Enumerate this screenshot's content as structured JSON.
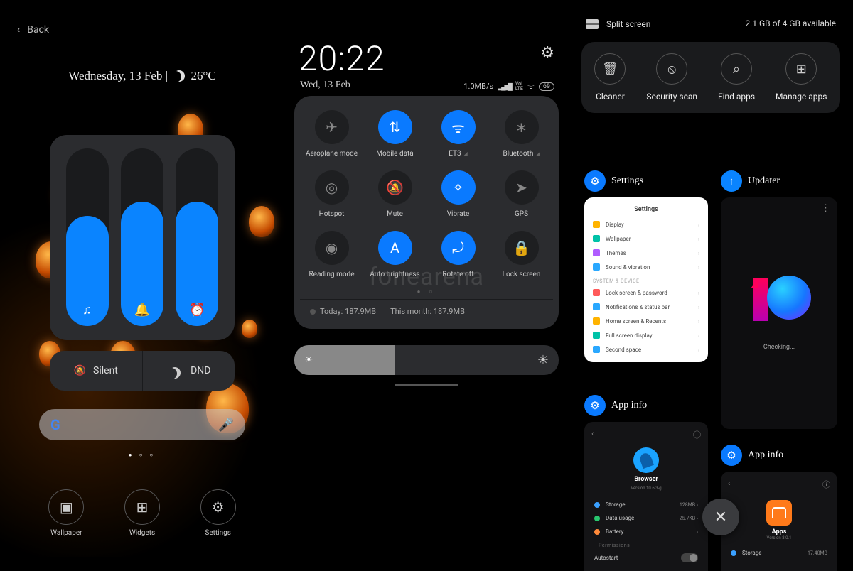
{
  "col1": {
    "back": "Back",
    "date_line": "Wednesday, 13 Feb",
    "temp": "26°C",
    "sliders": [
      {
        "fill_pct": 62
      },
      {
        "fill_pct": 70
      },
      {
        "fill_pct": 70
      }
    ],
    "silent": "Silent",
    "dnd": "DND",
    "dock": [
      {
        "label": "Wallpaper"
      },
      {
        "label": "Widgets"
      },
      {
        "label": "Settings"
      }
    ]
  },
  "col2": {
    "time": "20:22",
    "date": "Wed, 13 Feb",
    "net_speed": "1.0MB/s",
    "battery": "69",
    "toggles": [
      {
        "label": "Aeroplane mode",
        "on": false,
        "glyph": "✈"
      },
      {
        "label": "Mobile data",
        "on": true,
        "glyph": "⇅"
      },
      {
        "label": "ET3",
        "on": true,
        "glyph": "ᯤ",
        "chev": true
      },
      {
        "label": "Bluetooth",
        "on": false,
        "glyph": "∗",
        "chev": true
      },
      {
        "label": "Hotspot",
        "on": false,
        "glyph": "◎"
      },
      {
        "label": "Mute",
        "on": false,
        "glyph": "🔕"
      },
      {
        "label": "Vibrate",
        "on": true,
        "glyph": "✧"
      },
      {
        "label": "GPS",
        "on": false,
        "glyph": "➤"
      },
      {
        "label": "Reading mode",
        "on": false,
        "glyph": "◉"
      },
      {
        "label": "Auto brightness",
        "on": true,
        "glyph": "A"
      },
      {
        "label": "Rotate off",
        "on": true,
        "glyph": "⤾"
      },
      {
        "label": "Lock screen",
        "on": false,
        "glyph": "🔒"
      }
    ],
    "data_today": "Today: 187.9MB",
    "data_month": "This month: 187.9MB"
  },
  "col3": {
    "split": "Split screen",
    "mem": "2.1 GB of 4 GB available",
    "tools": [
      {
        "label": "Cleaner",
        "glyph": "🗑"
      },
      {
        "label": "Security scan",
        "glyph": "⦸"
      },
      {
        "label": "Find apps",
        "glyph": "⌕"
      },
      {
        "label": "Manage apps",
        "glyph": "⊞"
      }
    ],
    "cards": {
      "settings": {
        "title": "Settings",
        "heading": "Settings",
        "rows": [
          {
            "label": "Display",
            "color": "#ffb300"
          },
          {
            "label": "Wallpaper",
            "color": "#00c2a8"
          },
          {
            "label": "Themes",
            "color": "#b05cff"
          },
          {
            "label": "Sound & vibration",
            "color": "#2aa8ff"
          }
        ],
        "category": "SYSTEM & DEVICE",
        "rows2": [
          {
            "label": "Lock screen & password",
            "color": "#ff5a5a"
          },
          {
            "label": "Notifications & status bar",
            "color": "#2aa8ff"
          },
          {
            "label": "Home screen & Recents",
            "color": "#ffb300"
          },
          {
            "label": "Full screen display",
            "color": "#00c2a8"
          },
          {
            "label": "Second space",
            "color": "#2aa8ff"
          }
        ]
      },
      "updater": {
        "title": "Updater",
        "status": "Checking..."
      },
      "appinfo1": {
        "title": "App info",
        "app_name": "Browser",
        "app_ver": "Version 10.6.3-g",
        "rows": [
          {
            "label": "Storage",
            "value": "128MB",
            "color": "#3aa0ff"
          },
          {
            "label": "Data usage",
            "value": "25.7KB",
            "color": "#29c76f"
          },
          {
            "label": "Battery",
            "value": "",
            "color": "#ff8a3a"
          }
        ],
        "perm_label": "Permissions",
        "autostart": "Autostart"
      },
      "appinfo2": {
        "title": "App info",
        "app_name": "Apps",
        "app_ver": "Version 8.0.1",
        "storage_label": "Storage",
        "storage_value": "17.40MB"
      }
    }
  },
  "watermark": "fonearena"
}
